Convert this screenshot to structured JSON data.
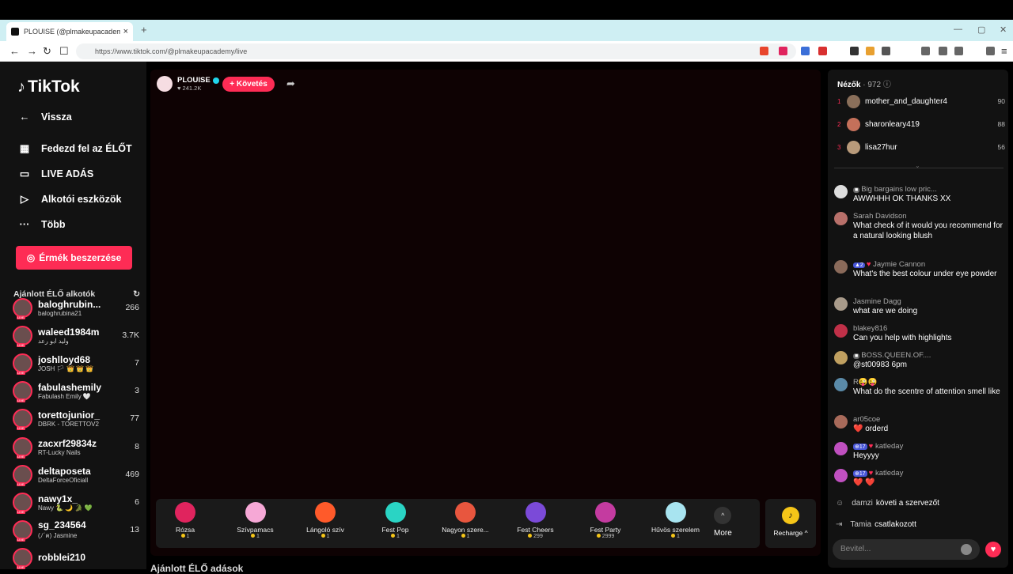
{
  "browser": {
    "tab_title": "PLOUISE (@plmakeupacademy)",
    "tab_close": "×",
    "new_tab": "+",
    "url": "https://www.tiktok.com/@plmakeupacademy/live"
  },
  "sidebar": {
    "logo": "TikTok",
    "back": "Vissza",
    "nav": [
      "Fedezd fel az ÉLŐT",
      "LIVE ADÁS",
      "Alkotói eszközök",
      "Több"
    ],
    "coins_button": "Érmék beszerzése",
    "recommended_title": "Ajánlott ÉLŐ alkotók",
    "creators": [
      {
        "name": "baloghrubin...",
        "sub": "baloghrubina21",
        "count": "266"
      },
      {
        "name": "waleed1984m",
        "sub": "وليد ابو رعد",
        "count": "3.7K"
      },
      {
        "name": "joshlloyd68",
        "sub": "JOSH 🏳 👑 👑 👑",
        "count": "7"
      },
      {
        "name": "fabulashemily",
        "sub": "Fabulash Emily 🤍",
        "count": "3"
      },
      {
        "name": "torettojunior_",
        "sub": "DBRK - TORETTOV2",
        "count": "77"
      },
      {
        "name": "zacxrf29834z",
        "sub": "RT-Lucky Nails",
        "count": "8"
      },
      {
        "name": "deltaposeta",
        "sub": "DeltaForceOficiall",
        "count": "469"
      },
      {
        "name": "nawy1x_",
        "sub": "Nawy 🐍 🌙 🐊 💚",
        "count": "6"
      },
      {
        "name": "sg_234564",
        "sub": "(ﾉ´ฅ) Jasmine",
        "count": "13"
      },
      {
        "name": "robblei210",
        "sub": "",
        "count": ""
      }
    ],
    "bottom_cut": "Ajánlott ÉLŐ adások"
  },
  "stream": {
    "host_name": "PLOUISE",
    "host_likes": "241.2K",
    "follow_button": "+ Követés"
  },
  "gifts": [
    {
      "name": "Rózsa",
      "price": "1",
      "color": "#e0245e"
    },
    {
      "name": "Szívpamacs",
      "price": "1",
      "color": "#f6a8d6"
    },
    {
      "name": "Lángoló szív",
      "price": "1",
      "color": "#ff5a2a"
    },
    {
      "name": "Fest Pop",
      "price": "1",
      "color": "#2ad4c4"
    },
    {
      "name": "Nagyon szere...",
      "price": "1",
      "color": "#e8563e"
    },
    {
      "name": "Fest Cheers",
      "price": "299",
      "color": "#7b4ad8"
    },
    {
      "name": "Fest Party",
      "price": "2999",
      "color": "#c43ba0"
    },
    {
      "name": "Hűvös szerelem",
      "price": "1",
      "color": "#a8e4f0"
    }
  ],
  "gift_more": "More",
  "recharge": "Recharge",
  "viewers": {
    "title": "Nézők",
    "count": "· 972",
    "top": [
      {
        "rank": "1",
        "name": "mother_and_daughter4",
        "score": "90",
        "color": "#8a6f5a"
      },
      {
        "rank": "2",
        "name": "sharonleary419",
        "score": "88",
        "color": "#c4705a"
      },
      {
        "rank": "3",
        "name": "lisa27hur",
        "score": "56",
        "color": "#b89a7a"
      }
    ]
  },
  "chat": [
    {
      "user": "Big bargains low pric...",
      "text": "AWWHHH OK THANKS XX",
      "color": "#ddd"
    },
    {
      "user": "Sarah Davidson",
      "text": "What check of it would you recommend for a natural looking blush",
      "color": "#b8706a"
    },
    {
      "user": "Jaymie Cannon",
      "text": "What's the best colour under eye powder",
      "color": "#8a6a5a"
    },
    {
      "user": "Jasmine Dagg",
      "text": "what are we doing",
      "color": "#a89a8a"
    },
    {
      "user": "blakey816",
      "text": "Can you help with highlights",
      "color": "#c03048"
    },
    {
      "user": "BOSS.QUEEN.OF....",
      "text": "@st00983 6pm",
      "color": "#c0a060"
    },
    {
      "user": "R😜😜",
      "text": "What do the scentre of attention smell like",
      "color": "#5a8aa8"
    },
    {
      "user": "ar05coe",
      "text": "❤️ orderd",
      "color": "#a86a5a"
    },
    {
      "user": "katleday",
      "text": "Heyyyy",
      "color": "#c050c0"
    },
    {
      "user": "katleday",
      "text": "❤️ ❤️",
      "color": "#c050c0"
    }
  ],
  "system": [
    {
      "who": "damzi",
      "text": "követi a szervezőt"
    },
    {
      "who": "Tamia",
      "text": "csatlakozott"
    }
  ],
  "input_placeholder": "Bevitel..."
}
